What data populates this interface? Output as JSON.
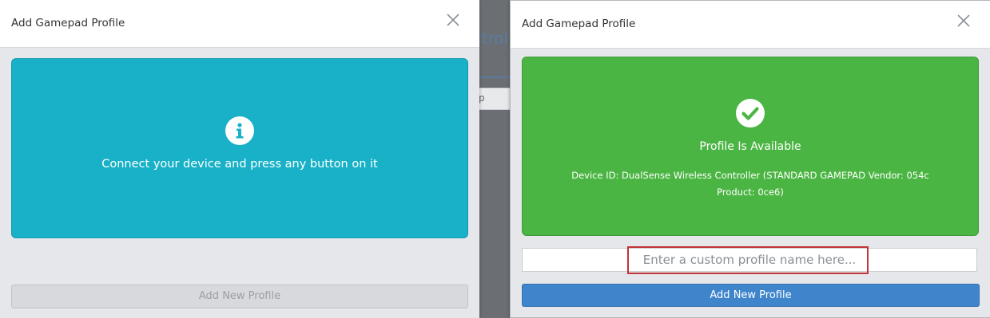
{
  "background": {
    "partial_text": "ntrol",
    "partial_box_text": "p"
  },
  "left_dialog": {
    "title": "Add Gamepad Profile",
    "close_icon": "close-icon",
    "panel_icon": "info-icon",
    "panel_color": "#18b1c7",
    "message": "Connect your device and press any button on it",
    "add_button_label": "Add New Profile",
    "add_button_state": "disabled"
  },
  "right_dialog": {
    "title": "Add Gamepad Profile",
    "close_icon": "close-icon",
    "panel_icon": "check-circle-icon",
    "panel_color": "#4bb543",
    "status_title": "Profile Is Available",
    "device_info": "Device ID: DualSense Wireless Controller (STANDARD GAMEPAD Vendor: 054c Product: 0ce6)",
    "name_input": {
      "value": "",
      "placeholder": "Enter a custom profile name here..."
    },
    "highlight_color": "#c0343a",
    "add_button_label": "Add New Profile",
    "add_button_color": "#3f85cc"
  }
}
